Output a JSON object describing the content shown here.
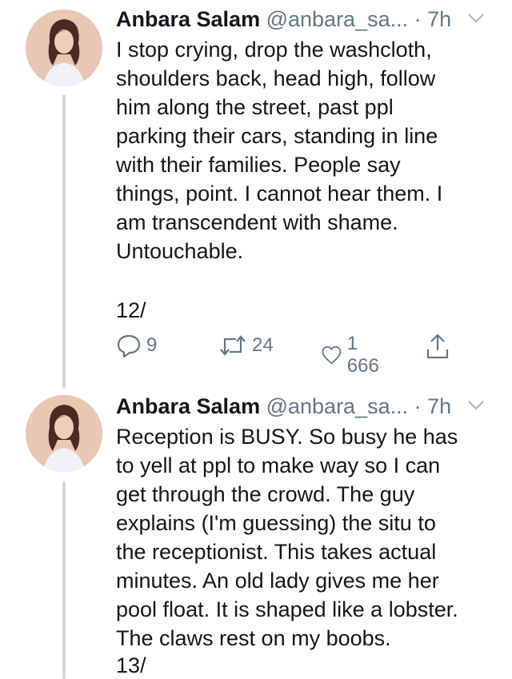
{
  "colors": {
    "text": "#14171a",
    "muted": "#657786",
    "thread_line": "#cfd9de",
    "avatar_bg": "#e9c7b4"
  },
  "tweets": [
    {
      "name": "Anbara Salam",
      "handle": "@anbara_sa...",
      "dot": "·",
      "time": "7h",
      "lines": [
        "I stop crying, drop the washcloth,",
        "shoulders back, head high, follow",
        "him along the street, past ppl",
        "parking their cars, standing in line",
        "with their families. People say",
        "things, point. I cannot hear them. I",
        "am transcendent with shame.",
        "Untouchable."
      ],
      "thread_num": "12/",
      "replies": "9",
      "retweets": "24",
      "likes": "1 666"
    },
    {
      "name": "Anbara Salam",
      "handle": "@anbara_sa...",
      "dot": "·",
      "time": "7h",
      "lines": [
        "Reception is BUSY. So busy he has",
        "to yell at ppl to make way so I can",
        "get through the crowd. The guy",
        "explains (I'm guessing) the situ to",
        "the receptionist. This takes actual",
        "minutes. An old lady gives me her",
        "pool float. It is shaped like a lobster.",
        "The claws rest on my boobs."
      ],
      "thread_num": "13/"
    }
  ]
}
